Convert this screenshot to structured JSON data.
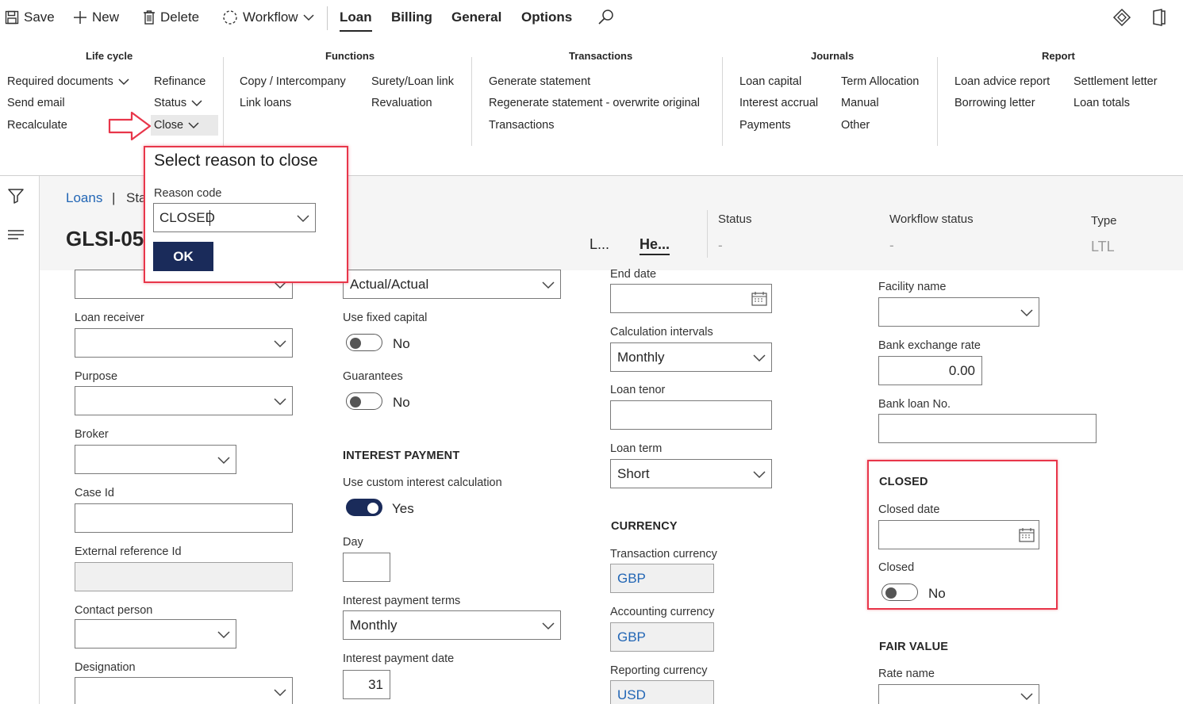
{
  "toolbar": {
    "save": "Save",
    "new": "New",
    "delete": "Delete",
    "workflow": "Workflow",
    "tabs": [
      "Loan",
      "Billing",
      "General",
      "Options"
    ]
  },
  "ribbon": {
    "lifecycle": {
      "title": "Life cycle",
      "required_documents": "Required documents",
      "send_email": "Send email",
      "recalculate": "Recalculate",
      "refinance": "Refinance",
      "status": "Status",
      "close": "Close"
    },
    "functions": {
      "title": "Functions",
      "copy_intercompany": "Copy / Intercompany",
      "link_loans": "Link loans",
      "surety_loan_link": "Surety/Loan link",
      "revaluation": "Revaluation"
    },
    "transactions": {
      "title": "Transactions",
      "generate_statement": "Generate statement",
      "regenerate_statement": "Regenerate statement - overwrite original",
      "transactions": "Transactions"
    },
    "journals": {
      "title": "Journals",
      "loan_capital": "Loan capital",
      "interest_accrual": "Interest accrual",
      "payments": "Payments",
      "term_allocation": "Term Allocation",
      "manual": "Manual",
      "other": "Other"
    },
    "report": {
      "title": "Report",
      "loan_advice_report": "Loan advice report",
      "borrowing_letter": "Borrowing letter",
      "settlement_letter": "Settlement letter",
      "loan_totals": "Loan totals"
    }
  },
  "popup": {
    "title": "Select reason to close",
    "reason_label": "Reason code",
    "reason_value": "CLOSED",
    "ok": "OK"
  },
  "header": {
    "breadcrumb_link": "Loans",
    "breadcrumb_sep": "|",
    "breadcrumb_next": "Sta",
    "record_title": "GLSI-05",
    "tab_l": "L...",
    "tab_he": "He...",
    "status_label": "Status",
    "status_value": "-",
    "workflow_label": "Workflow status",
    "workflow_value": "-",
    "type_label": "Type",
    "type_value": "LTL"
  },
  "col1": {
    "loan_receiver": "Loan receiver",
    "purpose": "Purpose",
    "broker": "Broker",
    "case_id": "Case Id",
    "external_reference": "External reference Id",
    "contact_person": "Contact person",
    "designation": "Designation"
  },
  "col2": {
    "day_count_value": "Actual/Actual",
    "use_fixed_capital": "Use fixed capital",
    "use_fixed_capital_value": "No",
    "guarantees": "Guarantees",
    "guarantees_value": "No",
    "interest_payment_heading": "INTEREST PAYMENT",
    "use_custom_interest": "Use custom interest calculation",
    "use_custom_interest_value": "Yes",
    "day": "Day",
    "interest_payment_terms": "Interest payment terms",
    "interest_payment_terms_value": "Monthly",
    "interest_payment_date": "Interest payment date",
    "interest_payment_date_value": "31"
  },
  "col3": {
    "end_date": "End date",
    "calculation_intervals": "Calculation intervals",
    "calculation_intervals_value": "Monthly",
    "loan_tenor": "Loan tenor",
    "loan_term": "Loan term",
    "loan_term_value": "Short",
    "currency_heading": "CURRENCY",
    "transaction_currency": "Transaction currency",
    "transaction_currency_value": "GBP",
    "accounting_currency": "Accounting currency",
    "accounting_currency_value": "GBP",
    "reporting_currency": "Reporting currency",
    "reporting_currency_value": "USD"
  },
  "col4": {
    "facility_name": "Facility name",
    "bank_exchange_rate": "Bank exchange rate",
    "bank_exchange_rate_value": "0.00",
    "bank_loan_no": "Bank loan No.",
    "closed_heading": "CLOSED",
    "closed_date": "Closed date",
    "closed": "Closed",
    "closed_value": "No",
    "fair_value_heading": "FAIR VALUE",
    "rate_name": "Rate name"
  },
  "colors": {
    "accent_navy": "#1a2b5a",
    "link_blue": "#2266b5",
    "highlight_red": "#e8364a"
  }
}
